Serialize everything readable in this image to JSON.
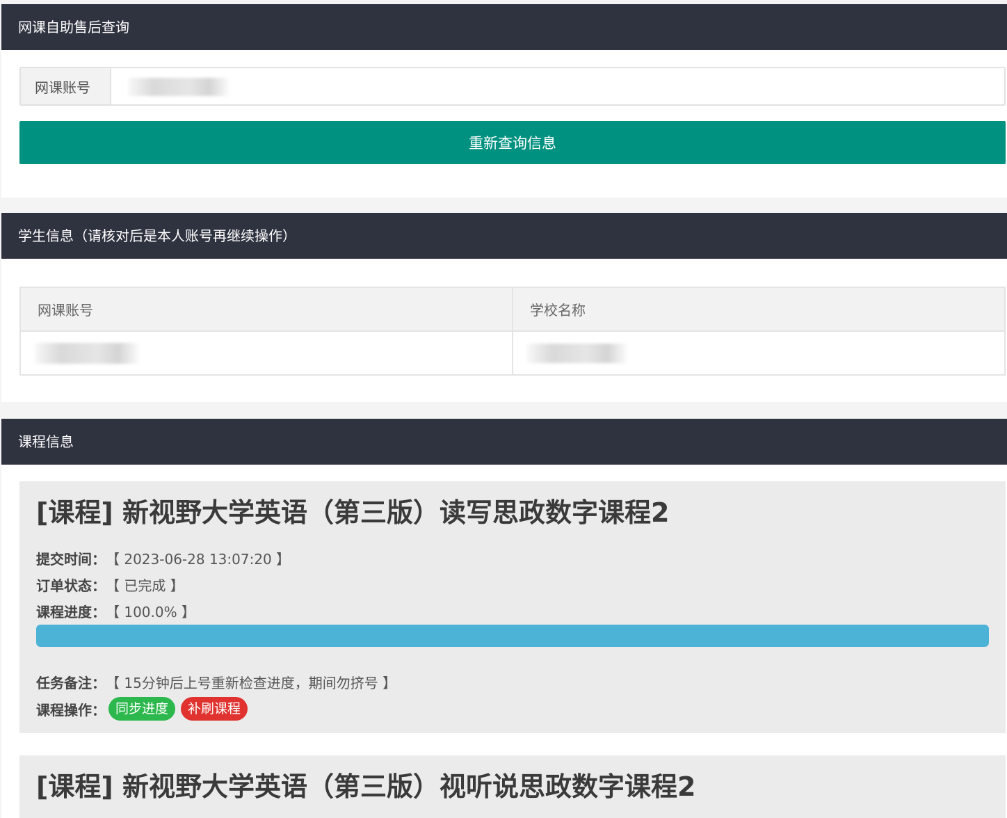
{
  "query_section": {
    "header": "网课自助售后查询",
    "account_label": "网课账号",
    "account_value": "",
    "query_button": "重新查询信息"
  },
  "student_section": {
    "header": "学生信息（请核对后是本人账号再继续操作）",
    "columns": [
      "网课账号",
      "学校名称"
    ]
  },
  "course_section": {
    "header": "课程信息",
    "courses": [
      {
        "title": "[课程] 新视野大学英语（第三版）读写思政数字课程2",
        "submit_time_label": "提交时间：",
        "submit_time": "【 2023-06-28 13:07:20 】",
        "status_label": "订单状态：",
        "status": "【 已完成 】",
        "progress_label": "课程进度：",
        "progress_text": "【 100.0% 】",
        "progress_percent": 100,
        "note_label": "任务备注：",
        "note": "【 15分钟后上号重新检查进度，期间勿挤号 】",
        "ops_label": "课程操作：",
        "sync_button": "同步进度",
        "redo_button": "补刷课程"
      },
      {
        "title": "[课程] 新视野大学英语（第三版）视听说思政数字课程2"
      }
    ]
  },
  "colors": {
    "header_bg": "#2f3340",
    "primary_button": "#009180",
    "progress_fill": "#4cb3d6",
    "badge_green": "#2db84d",
    "badge_red": "#e0332f"
  }
}
